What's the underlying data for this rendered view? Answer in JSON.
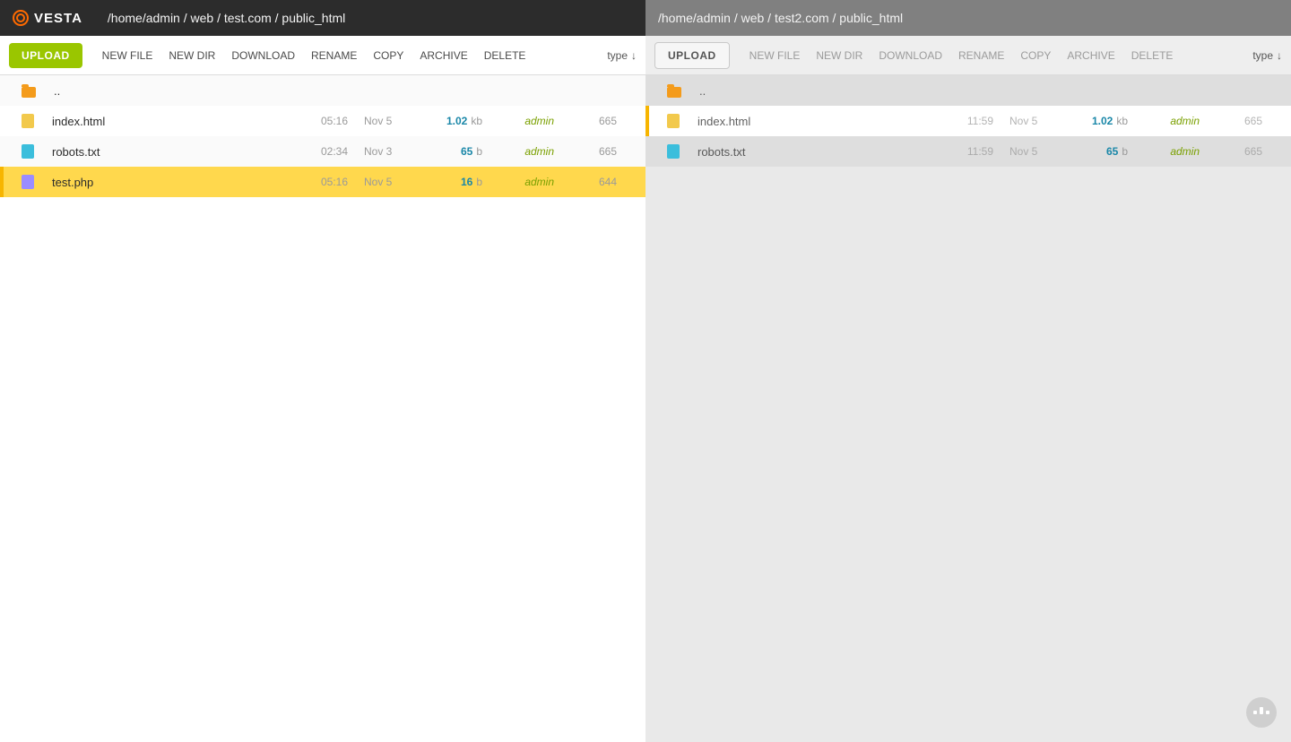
{
  "brand": "VESTA",
  "sort": {
    "label": "type",
    "arrow": "↓"
  },
  "toolbar": {
    "upload": "UPLOAD",
    "actions": [
      "NEW FILE",
      "NEW DIR",
      "DOWNLOAD",
      "RENAME",
      "COPY",
      "ARCHIVE",
      "DELETE"
    ]
  },
  "panes": [
    {
      "side": "left",
      "path": "/home/admin / web / test.com / public_html",
      "files": [
        {
          "icon": "folder",
          "name": "..",
          "time": "",
          "date": "",
          "size": "",
          "unit": "",
          "owner": "",
          "perm": "",
          "state": ""
        },
        {
          "icon": "html",
          "name": "index.html",
          "time": "05:16",
          "date": "Nov 5",
          "size": "1.02",
          "unit": "kb",
          "owner": "admin",
          "perm": "665",
          "state": ""
        },
        {
          "icon": "txt",
          "name": "robots.txt",
          "time": "02:34",
          "date": "Nov 3",
          "size": "65",
          "unit": "b",
          "owner": "admin",
          "perm": "665",
          "state": ""
        },
        {
          "icon": "php",
          "name": "test.php",
          "time": "05:16",
          "date": "Nov 5",
          "size": "16",
          "unit": "b",
          "owner": "admin",
          "perm": "644",
          "state": "selected"
        }
      ]
    },
    {
      "side": "right",
      "path": "/home/admin / web / test2.com / public_html",
      "files": [
        {
          "icon": "folder",
          "name": "..",
          "time": "",
          "date": "",
          "size": "",
          "unit": "",
          "owner": "",
          "perm": "",
          "state": ""
        },
        {
          "icon": "html",
          "name": "index.html",
          "time": "11:59",
          "date": "Nov 5",
          "size": "1.02",
          "unit": "kb",
          "owner": "admin",
          "perm": "665",
          "state": "active-right"
        },
        {
          "icon": "txt",
          "name": "robots.txt",
          "time": "11:59",
          "date": "Nov 5",
          "size": "65",
          "unit": "b",
          "owner": "admin",
          "perm": "665",
          "state": ""
        }
      ]
    }
  ]
}
